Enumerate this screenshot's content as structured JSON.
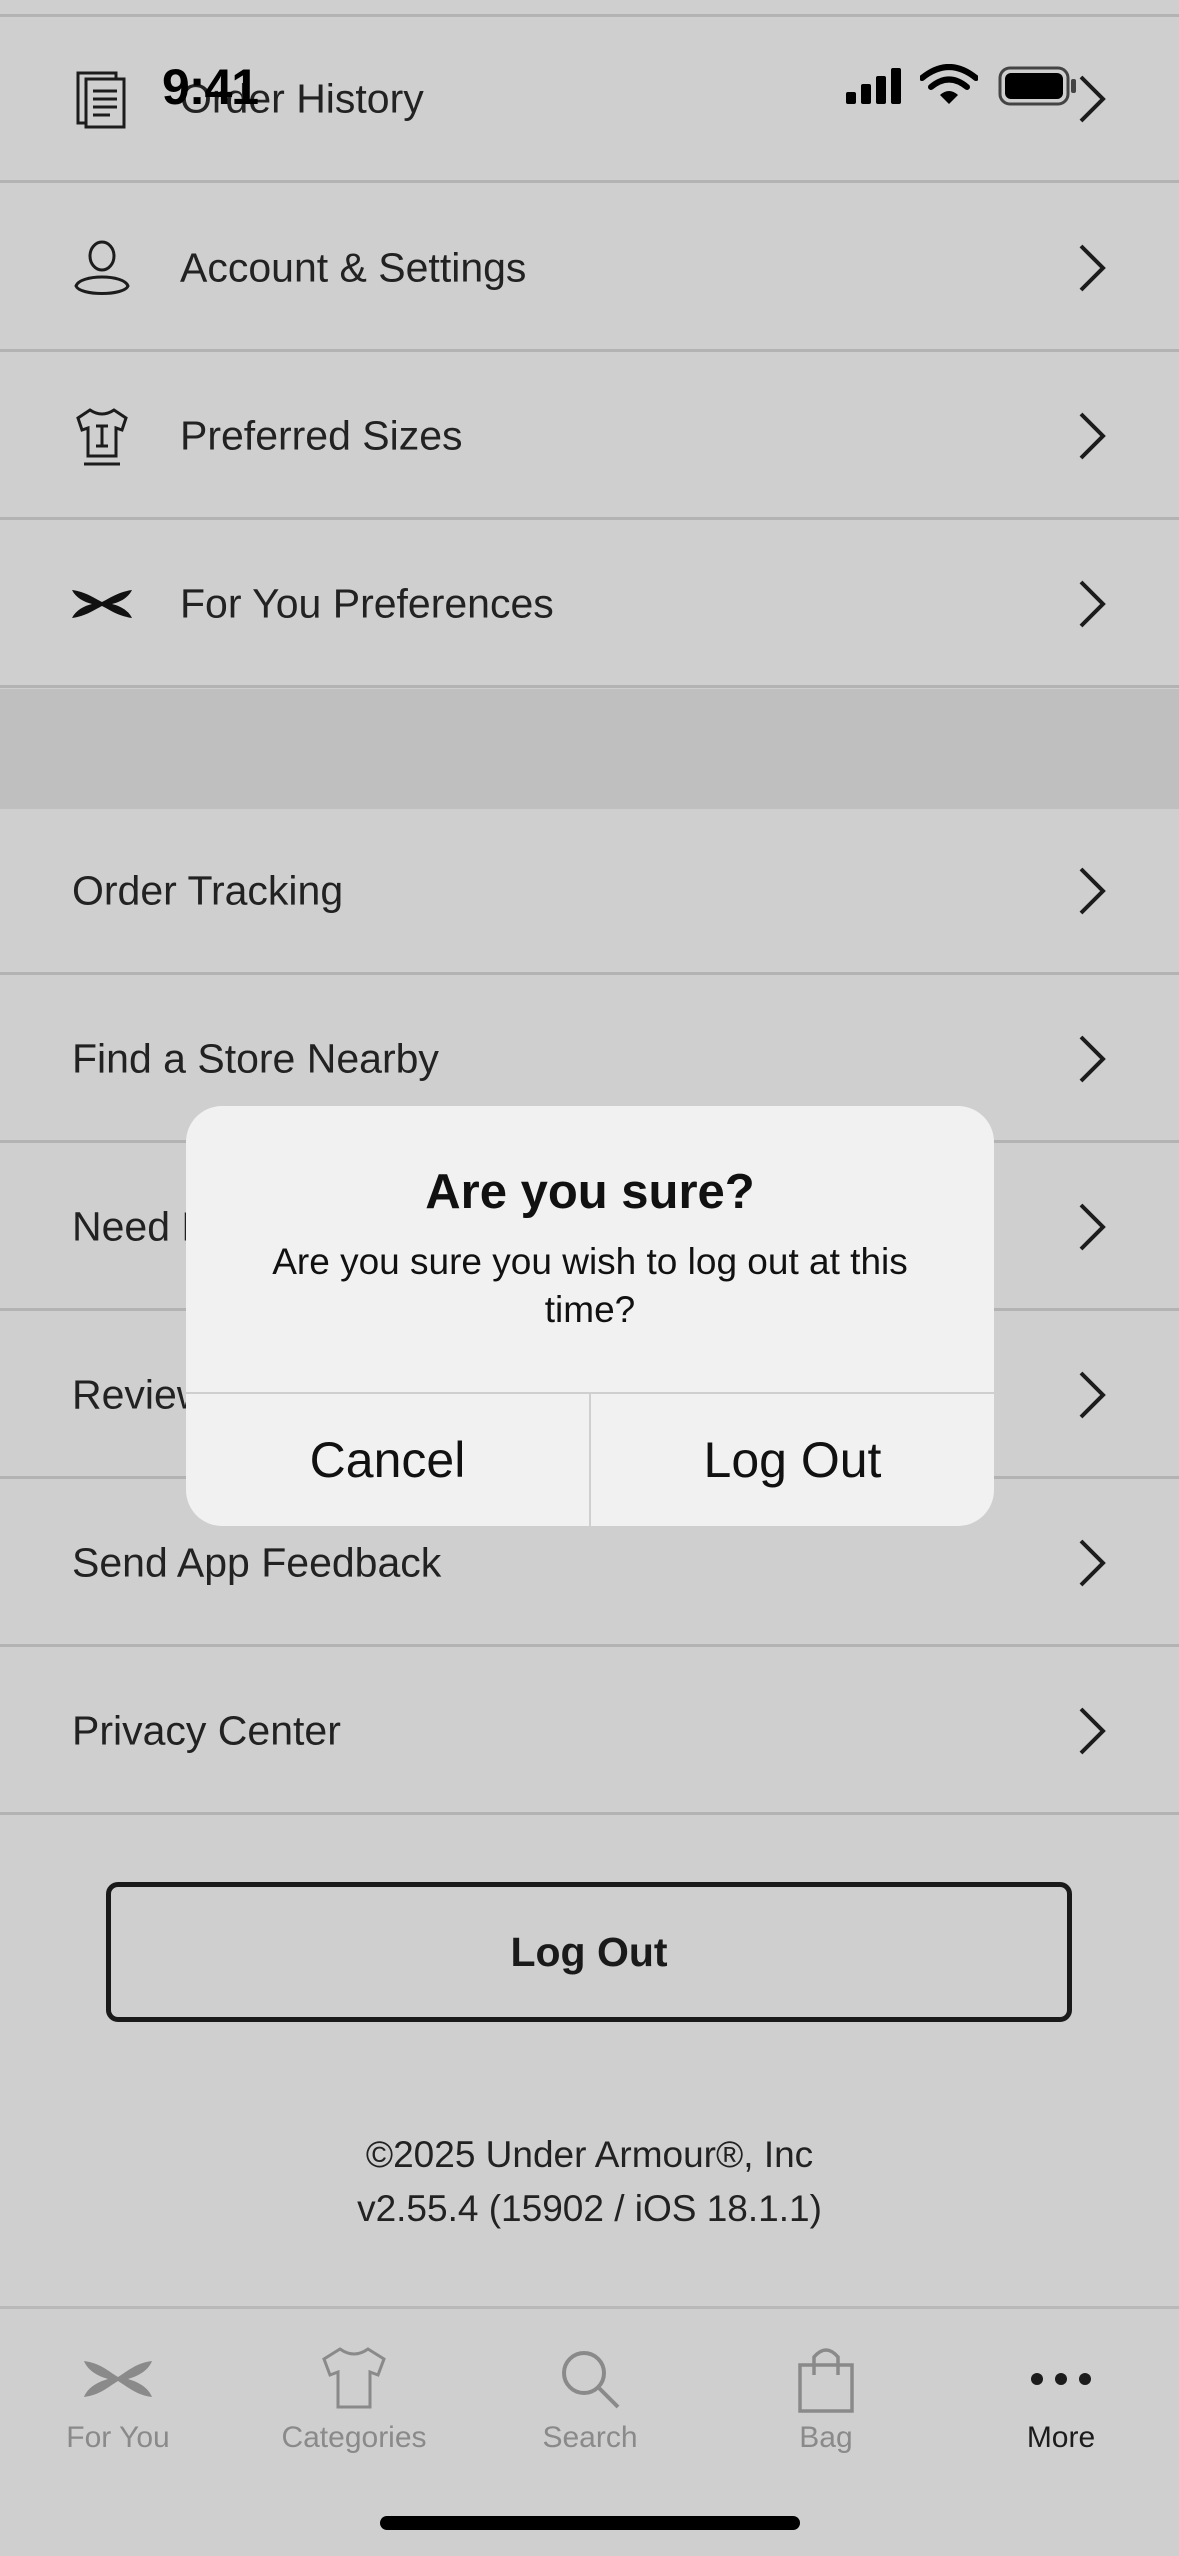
{
  "status_bar": {
    "time": "9:41"
  },
  "account_menu": [
    {
      "label": "Order History",
      "icon": "receipt-icon"
    },
    {
      "label": "Account & Settings",
      "icon": "user-icon"
    },
    {
      "label": "Preferred Sizes",
      "icon": "shirt-size-icon"
    },
    {
      "label": "For You Preferences",
      "icon": "under-armour-logo-icon"
    }
  ],
  "support_menu": [
    {
      "label": "Order Tracking"
    },
    {
      "label": "Find a Store Nearby"
    },
    {
      "label": "Need Help?"
    },
    {
      "label": "Review the App"
    },
    {
      "label": "Send App Feedback"
    },
    {
      "label": "Privacy Center"
    }
  ],
  "logout_button": {
    "label": "Log Out"
  },
  "footer": {
    "copyright": "©2025 Under Armour®, Inc",
    "version": "v2.55.4 (15902 / iOS 18.1.1)"
  },
  "dialog": {
    "title": "Are you sure?",
    "message": "Are you sure you wish to log out at this time?",
    "cancel": "Cancel",
    "confirm": "Log Out"
  },
  "tab_bar": [
    {
      "label": "For You",
      "icon": "under-armour-logo-icon"
    },
    {
      "label": "Categories",
      "icon": "shirt-icon"
    },
    {
      "label": "Search",
      "icon": "search-icon"
    },
    {
      "label": "Bag",
      "icon": "bag-icon"
    },
    {
      "label": "More",
      "icon": "more-icon",
      "active": true
    }
  ],
  "colors": {
    "overlay_bg": "#cfcfcf",
    "dialog_bg": "#f1f1f1",
    "inactive_tab": "#8a8a8a"
  }
}
